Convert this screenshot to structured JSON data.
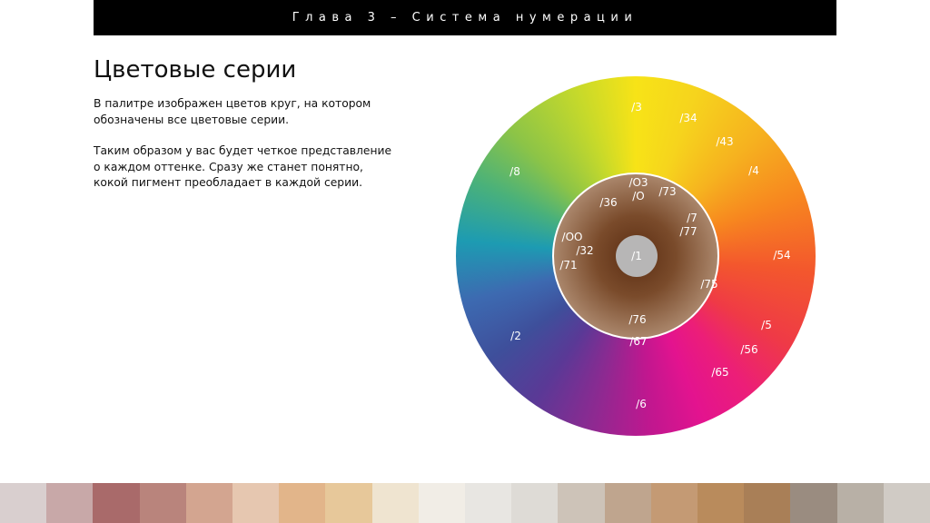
{
  "header": {
    "chapter": "Глава 3 – Система нумерации"
  },
  "title": "Цветовые серии",
  "description": {
    "p1": "В палитре изображен цветов круг, на котором обозначены все цветовые серии.",
    "p2": "Таким образом у вас будет четкое представление о каждом оттенке. Сразу же станет понятно, кокой пигмент преобладает в каждой серии."
  },
  "wheel": {
    "outer_labels": [
      "/3",
      "/34",
      "/43",
      "/4",
      "/54",
      "/5",
      "/56",
      "/65",
      "/6",
      "/2",
      "/8"
    ],
    "inner_labels": [
      "/O3",
      "/O",
      "/73",
      "/36",
      "/7",
      "/77",
      "/OO",
      "/32",
      "/71",
      "/75",
      "/76",
      "/67"
    ],
    "center_label": "/1"
  },
  "gallery_colors": [
    "#d9cfcf",
    "#c8a8a8",
    "#a96a6a",
    "#b9847c",
    "#d3a590",
    "#e6c7b0",
    "#e2b58a",
    "#e7c89a",
    "#efe4d0",
    "#f1ede6",
    "#e8e6e2",
    "#dedbd6",
    "#cdc3b8",
    "#bfa58e",
    "#c49a74",
    "#b98b5c",
    "#a97f57",
    "#9a8c80",
    "#b8b0a6",
    "#d0cbc5"
  ]
}
